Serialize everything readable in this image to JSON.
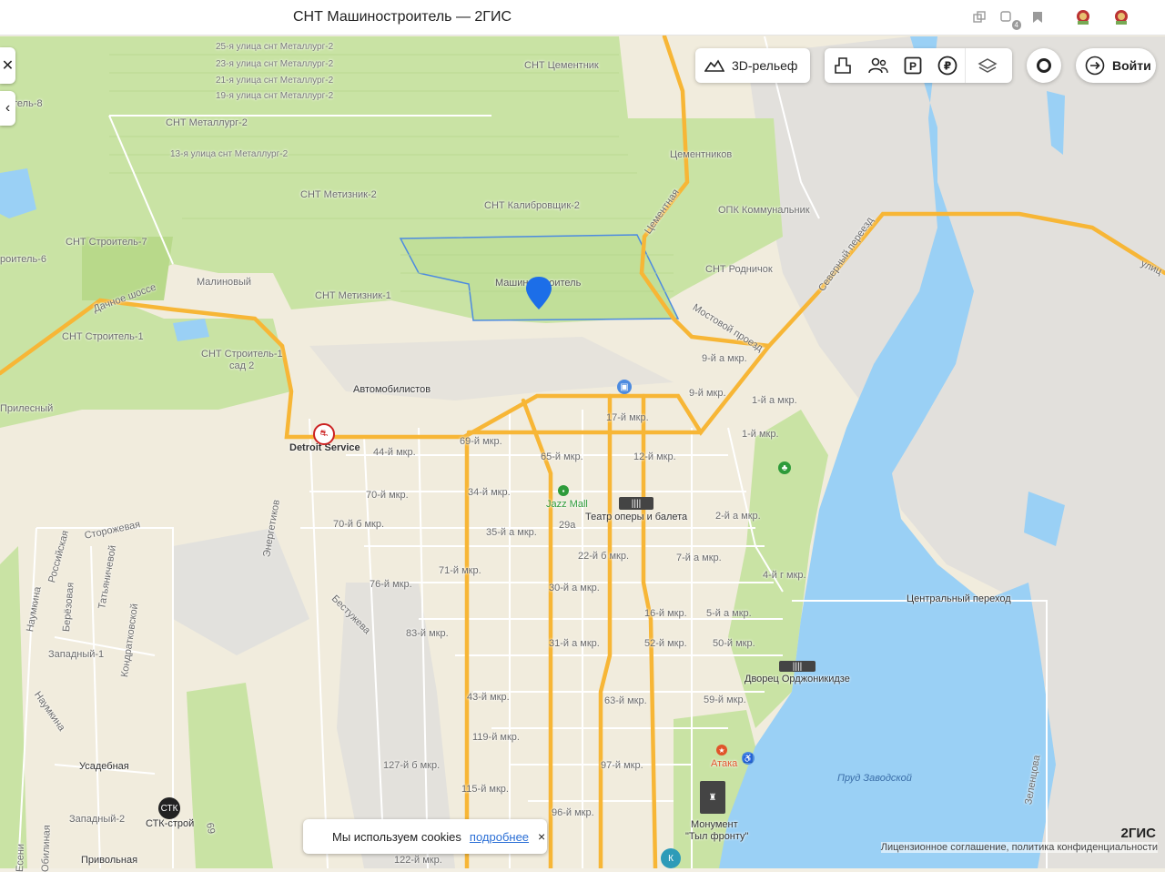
{
  "window_title": "СНТ Машиностроитель — 2ГИС",
  "topbar": {
    "tab_count": "4"
  },
  "toolbar": {
    "relief_label": "3D-рельеф",
    "login_label": "Войти"
  },
  "cookie_banner": {
    "text": "Мы используем cookies",
    "more": "подробнее",
    "close": "×"
  },
  "footer": {
    "logo": "2ГИС",
    "legal": "Лицензионное соглашение, политика конфиденциальности"
  },
  "marker": {
    "label": "Машиностроитель"
  },
  "labels": {
    "l25": "25-я улица снт Металлург-2",
    "l23": "23-я улица снт Металлург-2",
    "l21": "21-я улица снт Металлург-2",
    "l19": "19-я улица снт Металлург-2",
    "l13": "13-я улица снт Металлург-2",
    "metallurg2": "СНТ Металлург-2",
    "cement": "СНТ Цементник",
    "cementnikov": "Цементников",
    "metiznik2": "СНТ Метизник-2",
    "kalibr2": "СНТ Калибровщик-2",
    "opk": "ОПК Коммунальник",
    "stroitel7": "СНТ Строитель-7",
    "stroitel6": "роитель-6",
    "stroitel8": "тель-8",
    "malinoviy": "Малиновый",
    "metiznik1": "СНТ Метизник-1",
    "rodnichok": "СНТ Родничок",
    "dachnoe": "Дачное шоссе",
    "stroitel1": "СНТ Строитель-1",
    "stroitel1sad": "СНТ Строитель-1",
    "sad2": "сад 2",
    "cementnaya": "Цементная",
    "mostovoy": "Мостовой проезд",
    "severniy": "Северный переезд",
    "ulica": "улиц",
    "mkr9a": "9-й а мкр.",
    "mkr9": "9-й мкр.",
    "mkr1a": "1-й а мкр.",
    "mkr1": "1-й мкр.",
    "avtomob": "Автомобилистов",
    "prilesniy": "Прилесный",
    "detroit": "Detroit Service",
    "mkr44": "44-й мкр.",
    "mkr69": "69-й мкр.",
    "mkr17": "17-й мкр.",
    "mkr65": "65-й мкр.",
    "mkr12": "12-й мкр.",
    "mkr70": "70-й мкр.",
    "mkr34": "34-й мкр.",
    "jazz": "Jazz Mall",
    "teatr": "Театр оперы и балета",
    "mkr2a": "2-й а мкр.",
    "mkr70b": "70-й б мкр.",
    "n29a": "29а",
    "energetikov": "Энергетиков",
    "mkr35a": "35-й а мкр.",
    "mkr22b": "22-й б мкр.",
    "mkr7a": "7-й а мкр.",
    "storozh": "Сторожевая",
    "rossiyskaya": "Российская",
    "berezovaya": "Берёзовая",
    "tatyan": "Татьяничевой",
    "naumkina": "Наумкина",
    "kondrat": "Кондратковской",
    "mkr76": "76-й мкр.",
    "mkr71": "71-й мкр.",
    "mkr30a": "30-й а мкр.",
    "mkr4g": "4-й г мкр.",
    "central": "Центральный переход",
    "bestuzheva": "Бестужева",
    "mkr16": "16-й мкр.",
    "mkr5a": "5-й а мкр.",
    "zapadniy1": "Западный-1",
    "mkr83": "83-й мкр.",
    "mkr31a": "31-й а мкр.",
    "mkr52": "52-й мкр.",
    "mkr50": "50-й мкр.",
    "dvorec": "Дворец Орджоникидзе",
    "naumkina2": "Наумкина",
    "mkr43": "43-й мкр.",
    "mkr63": "63-й мкр.",
    "mkr59": "59-й мкр.",
    "mkr119": "119-й мкр.",
    "ataka": "Атака",
    "mkr127b": "127-й б мкр.",
    "mkr97": "97-й мкр.",
    "usadebnaya": "Усадебная",
    "prud": "Пруд Заводской",
    "zelenc": "Зеленцова",
    "mkr115": "115-й мкр.",
    "stk": "СТК-строй",
    "zapadniy2": "Западный-2",
    "mkr96": "96-й мкр.",
    "monument": "Монумент",
    "tyl": "\"Тыл фронту\"",
    "n69": "69",
    "eseni": "Есени",
    "obliyanie": "Обилиная",
    "privolnaya": "Привольная",
    "mkr122": "122-й мкр."
  }
}
